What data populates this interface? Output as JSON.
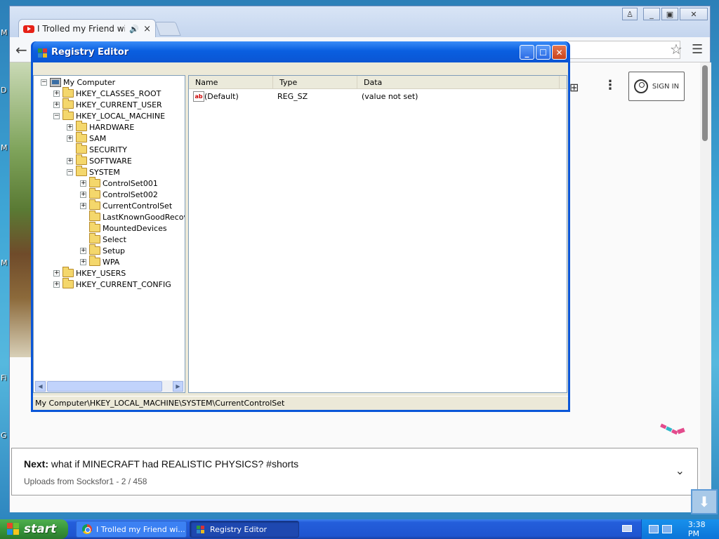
{
  "desktop": {
    "edge_letters": [
      "M",
      "D",
      "M",
      "M",
      "Fi",
      "G"
    ]
  },
  "browser": {
    "tab_title": "I Trolled my Friend with M",
    "tab_audio_icon": "speaker-icon",
    "tab_close": "×",
    "window_controls": [
      "user-icon",
      "minimize-icon",
      "restore-icon",
      "close-icon"
    ],
    "sign_in_label": "SIGN IN",
    "next_label": "Next:",
    "next_title": "what if MINECRAFT had REALISTIC PHYSICS? #shorts",
    "next_sub": "Uploads from Socksfor1 - 2 / 458"
  },
  "regedit": {
    "title": "Registry Editor",
    "tree": [
      {
        "label": "My Computer",
        "level": 0,
        "expander": "-",
        "icon": "computer"
      },
      {
        "label": "HKEY_CLASSES_ROOT",
        "level": 1,
        "expander": "+",
        "icon": "folder"
      },
      {
        "label": "HKEY_CURRENT_USER",
        "level": 1,
        "expander": "+",
        "icon": "folder"
      },
      {
        "label": "HKEY_LOCAL_MACHINE",
        "level": 1,
        "expander": "-",
        "icon": "folder"
      },
      {
        "label": "HARDWARE",
        "level": 2,
        "expander": "+",
        "icon": "folder"
      },
      {
        "label": "SAM",
        "level": 2,
        "expander": "+",
        "icon": "folder"
      },
      {
        "label": "SECURITY",
        "level": 2,
        "expander": "",
        "icon": "folder"
      },
      {
        "label": "SOFTWARE",
        "level": 2,
        "expander": "+",
        "icon": "folder"
      },
      {
        "label": "SYSTEM",
        "level": 2,
        "expander": "-",
        "icon": "folder"
      },
      {
        "label": "ControlSet001",
        "level": 3,
        "expander": "+",
        "icon": "folder"
      },
      {
        "label": "ControlSet002",
        "level": 3,
        "expander": "+",
        "icon": "folder"
      },
      {
        "label": "CurrentControlSet",
        "level": 3,
        "expander": "+",
        "icon": "folder"
      },
      {
        "label": "LastKnownGoodRecove",
        "level": 3,
        "expander": "",
        "icon": "folder"
      },
      {
        "label": "MountedDevices",
        "level": 3,
        "expander": "",
        "icon": "folder"
      },
      {
        "label": "Select",
        "level": 3,
        "expander": "",
        "icon": "folder"
      },
      {
        "label": "Setup",
        "level": 3,
        "expander": "+",
        "icon": "folder"
      },
      {
        "label": "WPA",
        "level": 3,
        "expander": "+",
        "icon": "folder"
      },
      {
        "label": "HKEY_USERS",
        "level": 1,
        "expander": "+",
        "icon": "folder"
      },
      {
        "label": "HKEY_CURRENT_CONFIG",
        "level": 1,
        "expander": "+",
        "icon": "folder"
      }
    ],
    "columns": [
      "Name",
      "Type",
      "Data"
    ],
    "values": [
      {
        "name": "(Default)",
        "type": "REG_SZ",
        "data": "(value not set)",
        "icon": "ab"
      }
    ],
    "status_path": "My Computer\\HKEY_LOCAL_MACHINE\\SYSTEM\\CurrentControlSet"
  },
  "taskbar": {
    "start_label": "start",
    "items": [
      {
        "label": "I Trolled my Friend wi...",
        "icon": "chrome-icon",
        "active": false
      },
      {
        "label": "Registry Editor",
        "icon": "registry-editor-icon",
        "active": true
      }
    ],
    "clock": "3:38 PM"
  }
}
